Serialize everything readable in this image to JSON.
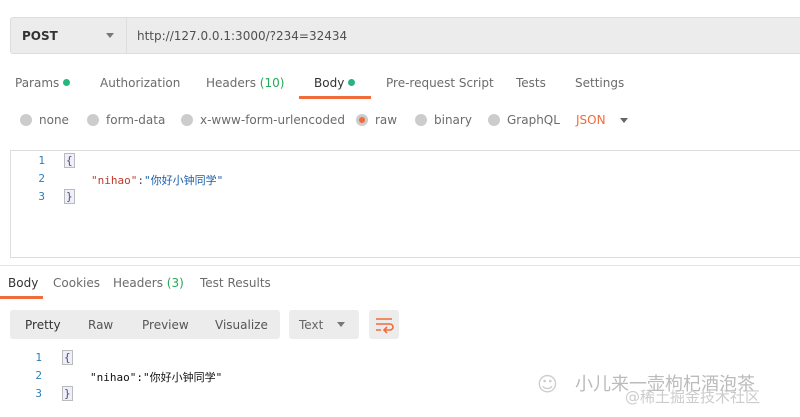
{
  "request": {
    "method": "POST",
    "url": "http://127.0.0.1:3000/?234=32434"
  },
  "tabs": [
    {
      "label": "Params",
      "dot": true
    },
    {
      "label": "Authorization"
    },
    {
      "label": "Headers",
      "count": "(10)"
    },
    {
      "label": "Body",
      "dot": true,
      "active": true
    },
    {
      "label": "Pre-request Script"
    },
    {
      "label": "Tests"
    },
    {
      "label": "Settings"
    }
  ],
  "body_types": [
    {
      "label": "none"
    },
    {
      "label": "form-data"
    },
    {
      "label": "x-www-form-urlencoded"
    },
    {
      "label": "raw",
      "selected": true
    },
    {
      "label": "binary"
    },
    {
      "label": "GraphQL"
    }
  ],
  "format": "JSON",
  "request_body": {
    "lines": [
      "1",
      "2",
      "3"
    ],
    "open": "{",
    "key": "\"nihao\"",
    "colon": ":",
    "value": "\"你好小钟同学\"",
    "close": "}"
  },
  "response_tabs": [
    {
      "label": "Body",
      "active": true
    },
    {
      "label": "Cookies"
    },
    {
      "label": "Headers",
      "count": "(3)"
    },
    {
      "label": "Test Results"
    }
  ],
  "view_modes": [
    "Pretty",
    "Raw",
    "Preview",
    "Visualize"
  ],
  "response_format": "Text",
  "response_body": {
    "lines": [
      "1",
      "2",
      "3"
    ],
    "open": "{",
    "key": "\"nihao\"",
    "colon": ":",
    "value": "\"你好小钟同学\"",
    "close": "}"
  },
  "watermark": {
    "line1": "小儿来一壶枸杞酒泡茶",
    "line2": "@稀土掘金技术社区"
  },
  "colors": {
    "accent": "#f26b3a",
    "green": "#26b47f"
  }
}
